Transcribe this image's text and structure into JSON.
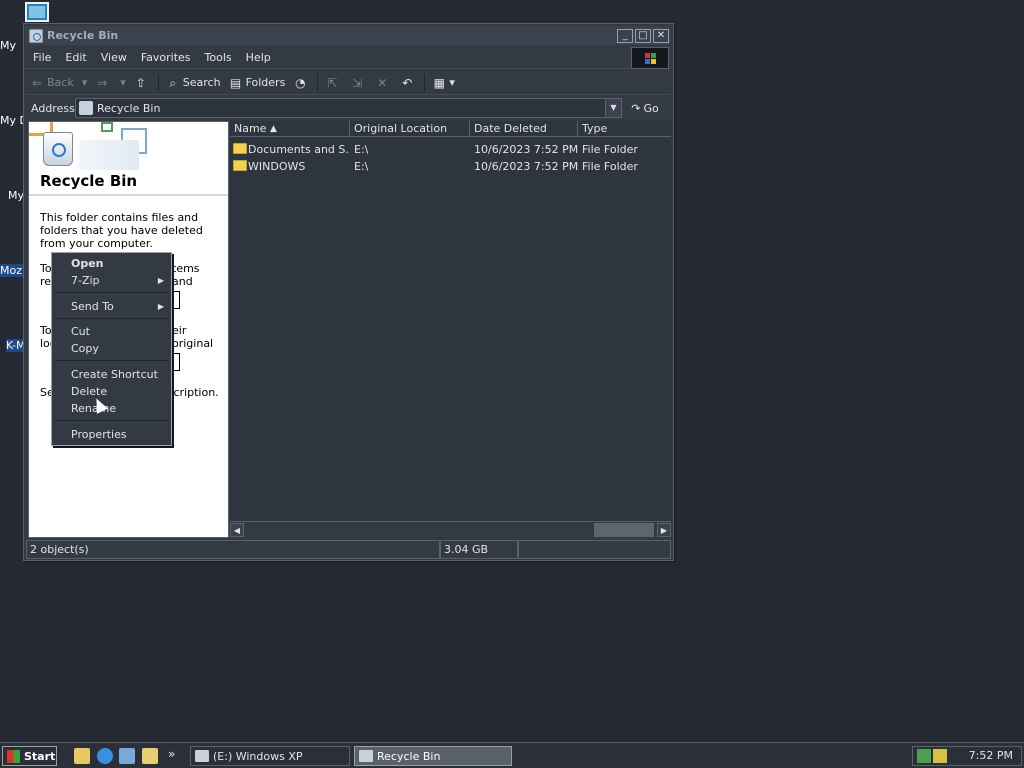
{
  "desktop": {
    "labels": [
      "My",
      "My D",
      "My",
      "Moz",
      "K-M"
    ]
  },
  "window": {
    "title": "Recycle Bin",
    "controls": {
      "minimize": "_",
      "maximize": "□",
      "close": "✕"
    },
    "menu": [
      "File",
      "Edit",
      "View",
      "Favorites",
      "Tools",
      "Help"
    ],
    "toolbar": {
      "back": "Back",
      "search": "Search",
      "folders": "Folders"
    },
    "address": {
      "label": "Address",
      "value": "Recycle Bin",
      "go": "Go"
    },
    "taskpane": {
      "title": "Recycle Bin",
      "description": "This folder contains files and folders that you have deleted from your computer.",
      "text2_start": "To",
      "text2_end": "tems and",
      "text2_start2": "re",
      "text3_start": "To",
      "text3_end": "eir original",
      "text3_start2": "loc",
      "text4_start": "Se",
      "text4_end": "escription."
    },
    "columns": [
      "Name",
      "Original Location",
      "Date Deleted",
      "Type"
    ],
    "files": [
      {
        "name": "Documents and S...",
        "location": "E:\\",
        "date": "10/6/2023 7:52 PM",
        "type": "File Folder"
      },
      {
        "name": "WINDOWS",
        "location": "E:\\",
        "date": "10/6/2023 7:52 PM",
        "type": "File Folder"
      }
    ],
    "status": {
      "objects": "2 object(s)",
      "size": "3.04 GB"
    }
  },
  "context_menu": {
    "open": "Open",
    "zip": "7-Zip",
    "sendto": "Send To",
    "cut": "Cut",
    "copy": "Copy",
    "shortcut": "Create Shortcut",
    "delete": "Delete",
    "rename": "Rename",
    "properties": "Properties"
  },
  "taskbar": {
    "start": "Start",
    "chevron": "»",
    "tasks": [
      "(E:) Windows XP",
      "Recycle Bin"
    ],
    "clock": "7:52 PM"
  }
}
